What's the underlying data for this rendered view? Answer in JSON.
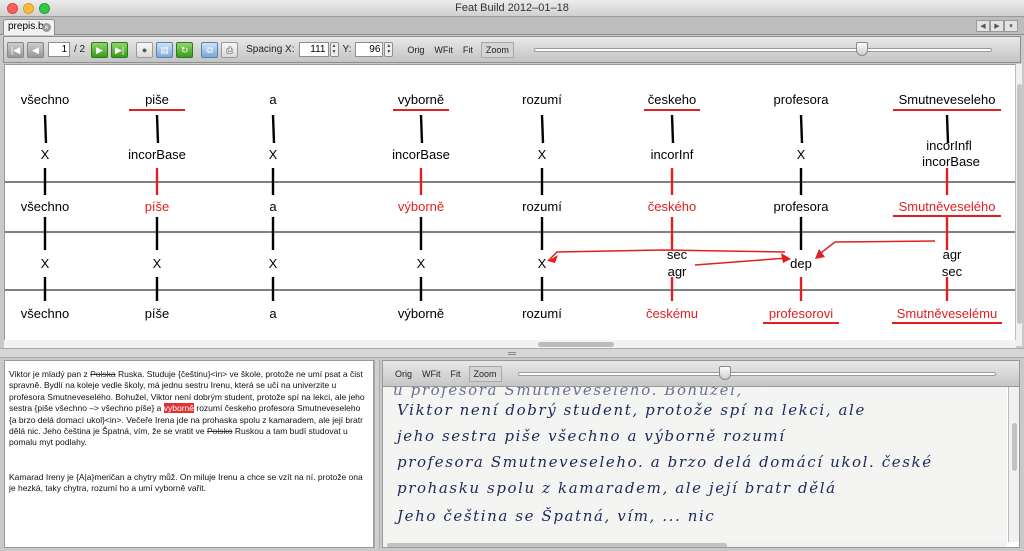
{
  "window": {
    "title": "Feat Build 2012–01–18"
  },
  "tab": {
    "label": "prepis.b",
    "close": "×"
  },
  "tabnav": [
    "◀",
    "▶",
    "▾"
  ],
  "toolbar": {
    "page_current": "1",
    "page_total": "/ 2",
    "spacing_x_label": "Spacing X:",
    "spacing_x": "111",
    "spacing_y_label": "Y:",
    "spacing_y": "96",
    "zoom_buttons": [
      "Orig",
      "WFit",
      "Fit",
      "Zoom"
    ],
    "zoom_selected": "Zoom",
    "slider_value": 0.72
  },
  "tree": {
    "columns": [
      {
        "top": "všechno",
        "mid1": [
          "X"
        ],
        "l2": "všechno",
        "mid2": [
          "X"
        ],
        "bottom": "všechno"
      },
      {
        "top": "piše",
        "mid1": [
          "incorBase"
        ],
        "l2": "píše",
        "mid2": [
          "X"
        ],
        "bottom": "píše"
      },
      {
        "top": "a",
        "mid1": [
          "X"
        ],
        "l2": "a",
        "mid2": [
          "X"
        ],
        "bottom": "a"
      },
      {
        "top": "vyborně",
        "mid1": [
          "incorBase"
        ],
        "l2": "výborně",
        "mid2": [
          "X"
        ],
        "bottom": "výborně"
      },
      {
        "top": "rozumí",
        "mid1": [
          "X"
        ],
        "l2": "rozumí",
        "mid2": [
          "X"
        ],
        "bottom": "rozumí"
      },
      {
        "top": "českeho",
        "mid1": [
          "incorInf"
        ],
        "l2": "českého",
        "mid2": [
          "sec",
          "agr"
        ],
        "bottom": "českému"
      },
      {
        "top": "profesora",
        "mid1": [
          "X"
        ],
        "l2": "profesora",
        "mid2": [
          "dep"
        ],
        "bottom": "profesorovi"
      },
      {
        "top": "Smutneveseleho",
        "mid1": [
          "incorInfl",
          "incorBase"
        ],
        "l2": "Smutněveselého",
        "mid2": [
          "agr",
          "sec"
        ],
        "bottom": "Smutněveselému"
      }
    ],
    "error_color": "#e02020",
    "text_color": "#000000"
  },
  "transcript": {
    "p1": [
      {
        "t": "Viktor je mladý pan z "
      },
      {
        "t": "Polska",
        "s": true
      },
      {
        "t": " Ruska.  Studuje {češtinu}<in> ve škole, protože ne umí psat a čist spravně.  Bydlí na koleje vedle školy, má jednu sestru Irenu, která se učí na univerzite u profesora Smutneveselého.  Bohužel, Viktor není dobrým student, protože spí na lekci, ale jeho sestra {piše všechno –> všechno píše} a "
      },
      {
        "t": "vyborně",
        "h": true
      },
      {
        "t": " rozumí českeho profesora Smutneveseleho {a brzo delá domací ukol}<in>.  Večeře Irena jde na prohaska spolu z kamaradem, ale její bratr dělá nic.  Jeho čeština je Špatná, vím, že se vratit ve "
      },
      {
        "t": "Polsko",
        "s": true
      },
      {
        "t": " Ruskou a tam budí studovat u pomalu myt podlahy."
      }
    ],
    "p2": [
      {
        "t": "Kamarad Ireny je {A|a}meričan a chytry můž.  On miluje Irenu a chce se vzít na ní.  protože ona je hezká, taky chytra, rozumí ho a umí vyborně vařit."
      }
    ]
  },
  "image_panel": {
    "zoom_buttons": [
      "Orig",
      "WFit",
      "Fit",
      "Zoom"
    ],
    "zoom_selected": "Zoom",
    "slider_value": 0.43,
    "lines": [
      "u profesora Smutneveseleho. Bohužel,",
      "Viktor není dobrý student, protože spí na lekci, ale",
      "jeho sestra piše všechno a výborně rozumí",
      "profesora Smutneveseleho. a brzo delá domácí ukol. české",
      "prohasku spolu z kamaradem, ale její bratr dělá",
      "Jeho čeština se Špatná, vím, ... nic"
    ]
  }
}
